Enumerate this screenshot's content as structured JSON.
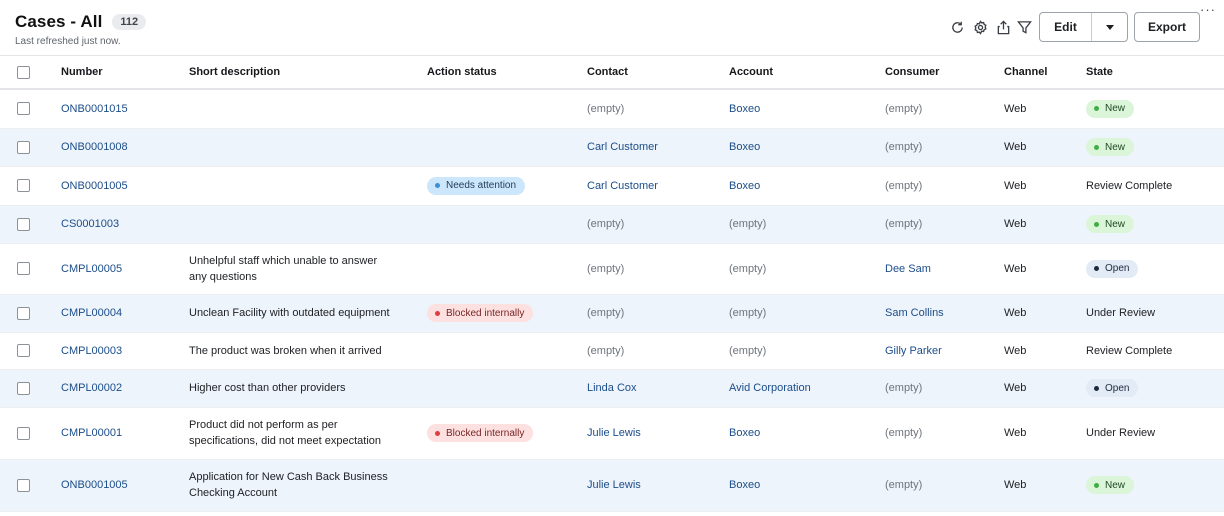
{
  "header": {
    "title": "Cases - All",
    "count": "112",
    "refreshed": "Last refreshed just now."
  },
  "toolbar": {
    "icons": [
      "refresh-icon",
      "settings-icon",
      "share-icon",
      "filter-icon"
    ],
    "edit_label": "Edit",
    "export_label": "Export",
    "more_label": "···"
  },
  "table": {
    "columns": [
      "Number",
      "Short description",
      "Action status",
      "Contact",
      "Account",
      "Consumer",
      "Channel",
      "State"
    ],
    "rows": [
      {
        "number": "ONB0001015",
        "desc1": "",
        "desc2": "",
        "action": "",
        "action_type": "",
        "contact": "(empty)",
        "contact_empty": true,
        "account": "Boxeo",
        "account_empty": false,
        "consumer": "(empty)",
        "consumer_empty": true,
        "channel": "Web",
        "state": "New",
        "state_type": "new"
      },
      {
        "number": "ONB0001008",
        "desc1": "",
        "desc2": "",
        "action": "",
        "action_type": "",
        "contact": "Carl Customer",
        "contact_empty": false,
        "account": "Boxeo",
        "account_empty": false,
        "consumer": "(empty)",
        "consumer_empty": true,
        "channel": "Web",
        "state": "New",
        "state_type": "new"
      },
      {
        "number": "ONB0001005",
        "desc1": "",
        "desc2": "",
        "action": "Needs attention",
        "action_type": "attention",
        "contact": "Carl Customer",
        "contact_empty": false,
        "account": "Boxeo",
        "account_empty": false,
        "consumer": "(empty)",
        "consumer_empty": true,
        "channel": "Web",
        "state": "Review Complete",
        "state_type": "text"
      },
      {
        "number": "CS0001003",
        "desc1": "",
        "desc2": "",
        "action": "",
        "action_type": "",
        "contact": "(empty)",
        "contact_empty": true,
        "account": "(empty)",
        "account_empty": true,
        "consumer": "(empty)",
        "consumer_empty": true,
        "channel": "Web",
        "state": "New",
        "state_type": "new"
      },
      {
        "number": "CMPL00005",
        "desc1": "Unhelpful staff which unable to answer",
        "desc2": "any questions",
        "action": "",
        "action_type": "",
        "contact": "(empty)",
        "contact_empty": true,
        "account": "(empty)",
        "account_empty": true,
        "consumer": "Dee Sam",
        "consumer_empty": false,
        "channel": "Web",
        "state": "Open",
        "state_type": "open"
      },
      {
        "number": "CMPL00004",
        "desc1": "Unclean Facility with outdated equipment",
        "desc2": "",
        "action": "Blocked internally",
        "action_type": "blocked",
        "contact": "(empty)",
        "contact_empty": true,
        "account": "(empty)",
        "account_empty": true,
        "consumer": "Sam Collins",
        "consumer_empty": false,
        "channel": "Web",
        "state": "Under Review",
        "state_type": "text"
      },
      {
        "number": "CMPL00003",
        "desc1": "The product was broken when it arrived",
        "desc2": "",
        "action": "",
        "action_type": "",
        "contact": "(empty)",
        "contact_empty": true,
        "account": "(empty)",
        "account_empty": true,
        "consumer": "Gilly Parker",
        "consumer_empty": false,
        "channel": "Web",
        "state": "Review Complete",
        "state_type": "text"
      },
      {
        "number": "CMPL00002",
        "desc1": "Higher cost than other providers",
        "desc2": "",
        "action": "",
        "action_type": "",
        "contact": "Linda Cox",
        "contact_empty": false,
        "account": "Avid Corporation",
        "account_empty": false,
        "consumer": "(empty)",
        "consumer_empty": true,
        "channel": "Web",
        "state": "Open",
        "state_type": "open"
      },
      {
        "number": "CMPL00001",
        "desc1": "Product did not perform as per",
        "desc2": "specifications, did not meet expectation",
        "action": "Blocked internally",
        "action_type": "blocked",
        "contact": "Julie Lewis",
        "contact_empty": false,
        "account": "Boxeo",
        "account_empty": false,
        "consumer": "(empty)",
        "consumer_empty": true,
        "channel": "Web",
        "state": "Under Review",
        "state_type": "text"
      },
      {
        "number": "ONB0001005",
        "desc1": "Application for New Cash Back Business",
        "desc2": "Checking Account",
        "action": "",
        "action_type": "",
        "contact": "Julie Lewis",
        "contact_empty": false,
        "account": "Boxeo",
        "account_empty": false,
        "consumer": "(empty)",
        "consumer_empty": true,
        "channel": "Web",
        "state": "New",
        "state_type": "new"
      }
    ]
  }
}
